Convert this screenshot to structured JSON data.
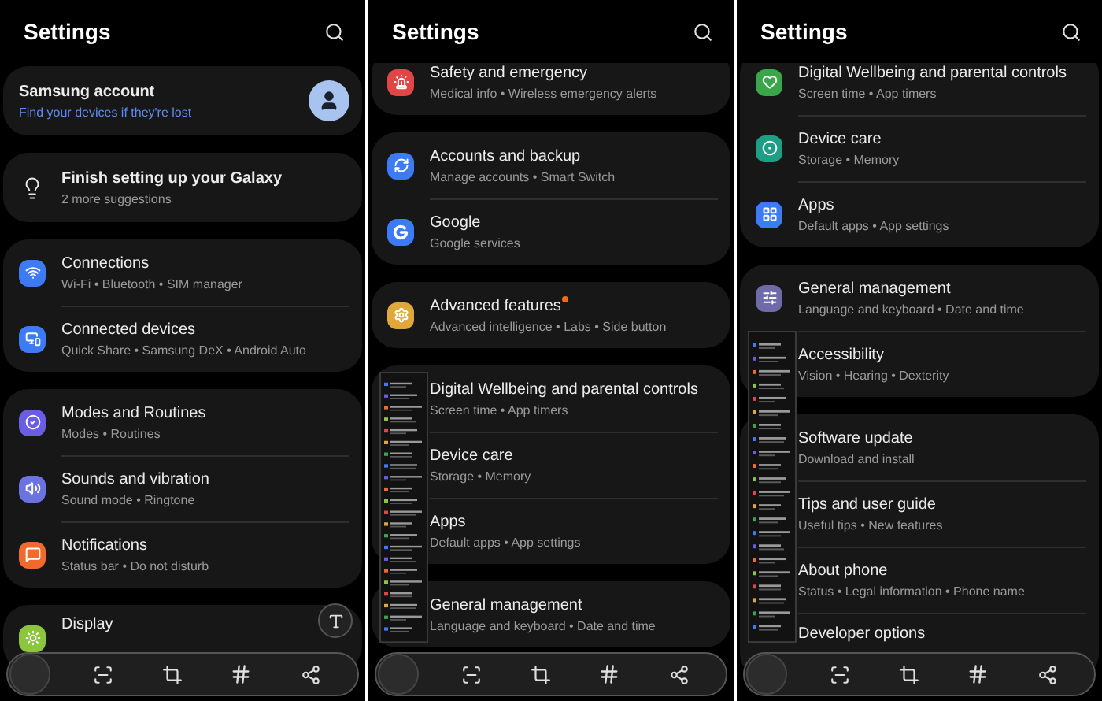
{
  "panels": [
    {
      "title": "Settings",
      "text_extract_button": true,
      "scroll_preview": false,
      "groups": [
        {
          "items": [
            {
              "kind": "account",
              "title": "Samsung account",
              "subtitle": "Find your devices if they're lost"
            }
          ]
        },
        {
          "items": [
            {
              "kind": "suggestion",
              "title": "Finish setting up your Galaxy",
              "subtitle": "2 more suggestions"
            }
          ]
        },
        {
          "items": [
            {
              "kind": "connections",
              "color": "#3d7bf5",
              "title": "Connections",
              "subtitle": "Wi-Fi • Bluetooth • SIM manager"
            },
            {
              "kind": "devices",
              "color": "#3d7bf5",
              "title": "Connected devices",
              "subtitle": "Quick Share • Samsung DeX • Android Auto"
            }
          ]
        },
        {
          "items": [
            {
              "kind": "routines",
              "color": "#6b5de3",
              "title": "Modes and Routines",
              "subtitle": "Modes • Routines"
            },
            {
              "kind": "sounds",
              "color": "#6b73e3",
              "title": "Sounds and vibration",
              "subtitle": "Sound mode • Ringtone"
            },
            {
              "kind": "notifications",
              "color": "#ef6a2c",
              "title": "Notifications",
              "subtitle": "Status bar • Do not disturb"
            }
          ]
        },
        {
          "items": [
            {
              "kind": "display",
              "color": "#8cc63f",
              "title": "Display"
            }
          ]
        }
      ]
    },
    {
      "title": "Settings",
      "text_extract_button": false,
      "scroll_preview": true,
      "groups": [
        {
          "items": [
            {
              "kind": "safety",
              "color": "#e04646",
              "title": "Safety and emergency",
              "subtitle": "Medical info • Wireless emergency alerts"
            }
          ]
        },
        {
          "items": [
            {
              "kind": "accounts",
              "color": "#3d7bf5",
              "title": "Accounts and backup",
              "subtitle": "Manage accounts • Smart Switch"
            },
            {
              "kind": "google",
              "color": "#3d7bf5",
              "title": "Google",
              "subtitle": "Google services"
            }
          ]
        },
        {
          "items": [
            {
              "kind": "advanced",
              "color": "#e0a83a",
              "title": "Advanced features",
              "subtitle": "Advanced intelligence • Labs • Side button",
              "badge": true
            }
          ]
        },
        {
          "items": [
            {
              "kind": "wellbeing",
              "title": "Digital Wellbeing and parental controls",
              "subtitle": "Screen time • App timers"
            },
            {
              "kind": "care",
              "title": "Device care",
              "subtitle": "Storage • Memory"
            },
            {
              "kind": "apps",
              "title": "Apps",
              "subtitle": "Default apps • App settings"
            }
          ]
        },
        {
          "items": [
            {
              "kind": "general",
              "title": "General management",
              "subtitle": "Language and keyboard • Date and time"
            }
          ]
        }
      ]
    },
    {
      "title": "Settings",
      "text_extract_button": false,
      "scroll_preview": true,
      "groups": [
        {
          "items": [
            {
              "kind": "wellbeing",
              "color": "#3aa64a",
              "title": "Digital Wellbeing and parental controls",
              "subtitle": "Screen time • App timers"
            },
            {
              "kind": "care",
              "color": "#1f9e86",
              "title": "Device care",
              "subtitle": "Storage • Memory"
            },
            {
              "kind": "apps",
              "color": "#3d7bf5",
              "title": "Apps",
              "subtitle": "Default apps • App settings"
            }
          ]
        },
        {
          "items": [
            {
              "kind": "general",
              "color": "#6f6aa8",
              "title": "General management",
              "subtitle": "Language and keyboard • Date and time"
            },
            {
              "kind": "accessibility",
              "title": "Accessibility",
              "subtitle": "Vision • Hearing • Dexterity"
            }
          ]
        },
        {
          "items": [
            {
              "kind": "update",
              "title": "Software update",
              "subtitle": "Download and install"
            },
            {
              "kind": "tips",
              "title": "Tips and user guide",
              "subtitle": "Useful tips • New features"
            },
            {
              "kind": "about",
              "title": "About phone",
              "subtitle": "Status • Legal information • Phone name"
            },
            {
              "kind": "developer",
              "title": "Developer options"
            }
          ]
        }
      ]
    }
  ]
}
